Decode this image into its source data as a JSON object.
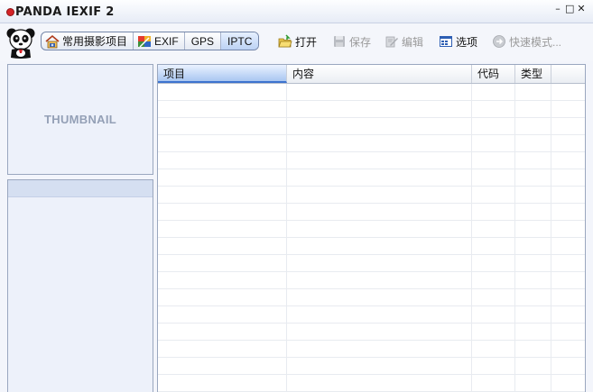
{
  "window": {
    "title": "PANDA IEXIF 2",
    "controls": [
      "–",
      "□",
      "✕"
    ]
  },
  "toolbar": {
    "tabs": [
      {
        "label": "常用摄影项目",
        "icon": "house-camera-icon",
        "active": false
      },
      {
        "label": "EXIF",
        "icon": "exif-icon",
        "active": false
      },
      {
        "label": "GPS",
        "icon": "",
        "active": false
      },
      {
        "label": "IPTC",
        "icon": "",
        "active": true
      }
    ],
    "open_label": "打开",
    "save_label": "保存",
    "edit_label": "编辑",
    "options_label": "选项",
    "quickmode_label": "快速模式..."
  },
  "thumbnail": {
    "label": "THUMBNAIL"
  },
  "grid": {
    "columns": [
      "项目",
      "内容",
      "代码",
      "类型"
    ],
    "sorted_column": "项目",
    "rows": []
  },
  "colors": {
    "accent": "#3d73cf",
    "panel_bg": "#edf1fa",
    "border": "#9aa7bf",
    "logo_red": "#d52327"
  }
}
